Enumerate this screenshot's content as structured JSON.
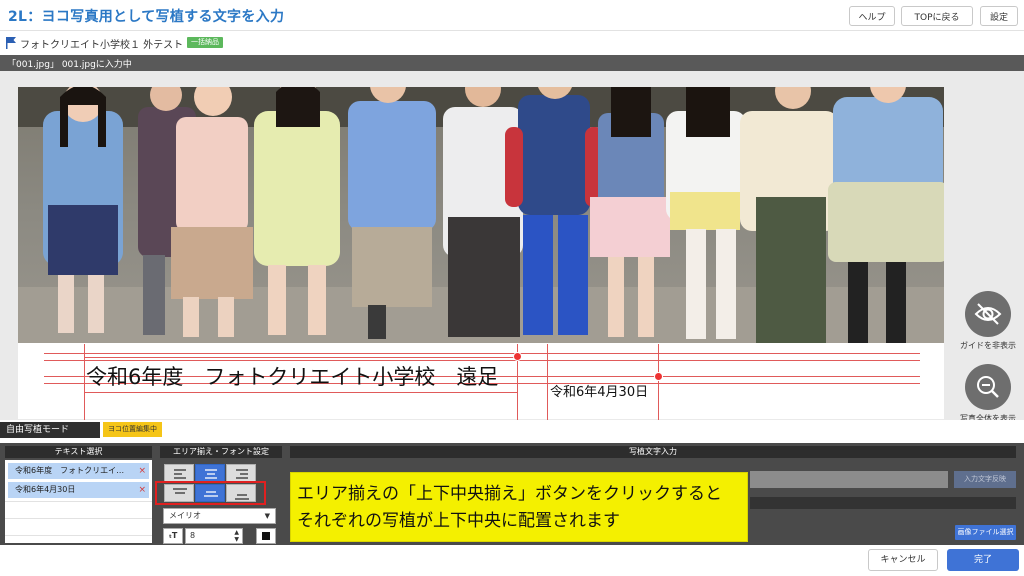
{
  "header": {
    "title": "2L：ヨコ写真用として写植する文字を入力",
    "help_label": "ヘルプ",
    "top_label": "TOPに戻る",
    "settings_label": "設定"
  },
  "subheader": {
    "title": "フォトクリエイト小学校１ 外テスト",
    "badge": "一括納品"
  },
  "status_bar": {
    "text": "「001.jpg」 001.jpgに入力中"
  },
  "canvas": {
    "text_box_1": "令和6年度　フォトクリエイト小学校　遠足",
    "text_box_2": "令和6年4月30日",
    "hide_guides_label": "ガイドを非表示",
    "show_full_label": "写真全体を表示"
  },
  "mode": {
    "label": "自由写植モード",
    "badge": "ヨコ位置編集中"
  },
  "panels": {
    "text_select": "テキスト選択",
    "align_font": "エリア揃え・フォント設定",
    "text_input": "写植文字入力"
  },
  "text_list": [
    "令和6年度　フォトクリエイ…",
    "令和6年4月30日"
  ],
  "font": {
    "name": "メイリオ",
    "size": "8"
  },
  "callout": {
    "line1": "エリア揃えの「上下中央揃え」ボタンをクリックすると",
    "line2": "それぞれの写植が上下中央に配置されます"
  },
  "buttons": {
    "input_text_copy": "入力文字反映",
    "image_file_select": "画像ファイル選択",
    "cancel": "キャンセル",
    "done": "完了"
  },
  "colors": {
    "accent": "#3f73d6",
    "title": "#2b78c5",
    "guide": "#e05a5a",
    "callout": "#f4f000",
    "highlight": "#e02020"
  }
}
